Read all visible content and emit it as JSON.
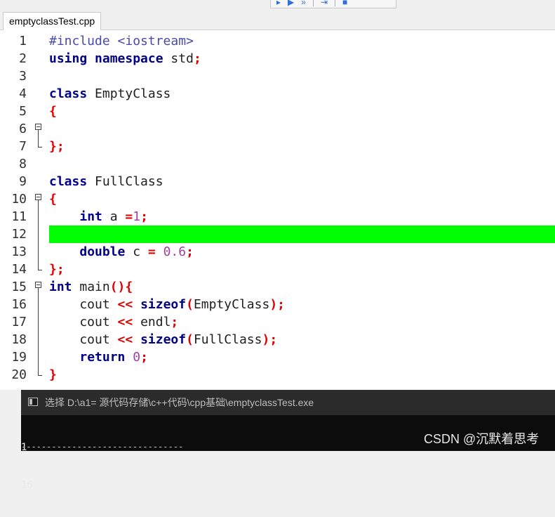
{
  "tab": {
    "file_name": "emptyclassTest.cpp"
  },
  "editor": {
    "lines": [
      {
        "num": "1",
        "segments": [
          {
            "t": "#include <iostream>",
            "c": "pp"
          }
        ]
      },
      {
        "num": "2",
        "segments": [
          {
            "t": "using",
            "c": "kw"
          },
          {
            "t": " ",
            "c": "pl"
          },
          {
            "t": "namespace",
            "c": "kw"
          },
          {
            "t": " std",
            "c": "pl"
          },
          {
            "t": ";",
            "c": "br"
          }
        ]
      },
      {
        "num": "3",
        "segments": []
      },
      {
        "num": "4",
        "segments": [
          {
            "t": "class",
            "c": "kw"
          },
          {
            "t": " EmptyClass",
            "c": "pl"
          }
        ]
      },
      {
        "num": "5",
        "segments": [
          {
            "t": "{",
            "c": "br"
          }
        ]
      },
      {
        "num": "6",
        "segments": []
      },
      {
        "num": "7",
        "segments": [
          {
            "t": "}",
            "c": "br"
          },
          {
            "t": ";",
            "c": "br"
          }
        ]
      },
      {
        "num": "8",
        "segments": []
      },
      {
        "num": "9",
        "segments": [
          {
            "t": "class",
            "c": "kw"
          },
          {
            "t": " FullClass",
            "c": "pl"
          }
        ]
      },
      {
        "num": "10",
        "segments": [
          {
            "t": "{",
            "c": "br"
          }
        ]
      },
      {
        "num": "11",
        "segments": [
          {
            "t": "    ",
            "c": "pl"
          },
          {
            "t": "int",
            "c": "kw"
          },
          {
            "t": " a ",
            "c": "pl"
          },
          {
            "t": "=",
            "c": "op"
          },
          {
            "t": "1",
            "c": "num"
          },
          {
            "t": ";",
            "c": "br"
          }
        ]
      },
      {
        "num": "12",
        "segments": [],
        "highlight": true
      },
      {
        "num": "13",
        "segments": [
          {
            "t": "    ",
            "c": "pl"
          },
          {
            "t": "double",
            "c": "kw"
          },
          {
            "t": " c ",
            "c": "pl"
          },
          {
            "t": "=",
            "c": "op"
          },
          {
            "t": " ",
            "c": "pl"
          },
          {
            "t": "0.6",
            "c": "num"
          },
          {
            "t": ";",
            "c": "br"
          }
        ]
      },
      {
        "num": "14",
        "segments": [
          {
            "t": "}",
            "c": "br"
          },
          {
            "t": ";",
            "c": "br"
          }
        ]
      },
      {
        "num": "15",
        "segments": [
          {
            "t": "int",
            "c": "kw"
          },
          {
            "t": " main",
            "c": "pl"
          },
          {
            "t": "(){",
            "c": "br"
          }
        ]
      },
      {
        "num": "16",
        "segments": [
          {
            "t": "    cout ",
            "c": "pl"
          },
          {
            "t": "<<",
            "c": "op"
          },
          {
            "t": " ",
            "c": "pl"
          },
          {
            "t": "sizeof",
            "c": "kw"
          },
          {
            "t": "(",
            "c": "br"
          },
          {
            "t": "EmptyClass",
            "c": "pl"
          },
          {
            "t": ");",
            "c": "br"
          }
        ]
      },
      {
        "num": "17",
        "segments": [
          {
            "t": "    cout ",
            "c": "pl"
          },
          {
            "t": "<<",
            "c": "op"
          },
          {
            "t": " endl",
            "c": "pl"
          },
          {
            "t": ";",
            "c": "br"
          }
        ]
      },
      {
        "num": "18",
        "segments": [
          {
            "t": "    cout ",
            "c": "pl"
          },
          {
            "t": "<<",
            "c": "op"
          },
          {
            "t": " ",
            "c": "pl"
          },
          {
            "t": "sizeof",
            "c": "kw"
          },
          {
            "t": "(",
            "c": "br"
          },
          {
            "t": "FullClass",
            "c": "pl"
          },
          {
            "t": ");",
            "c": "br"
          }
        ]
      },
      {
        "num": "19",
        "segments": [
          {
            "t": "    ",
            "c": "pl"
          },
          {
            "t": "return",
            "c": "kw"
          },
          {
            "t": " ",
            "c": "pl"
          },
          {
            "t": "0",
            "c": "num"
          },
          {
            "t": ";",
            "c": "br"
          }
        ]
      },
      {
        "num": "20",
        "segments": [
          {
            "t": "}",
            "c": "br"
          }
        ]
      }
    ],
    "highlight_color": "#00ff00"
  },
  "console": {
    "title": "选择 D:\\a1= 源代码存储\\c++代码\\cpp基础\\emptyclassTest.exe",
    "output_lines": [
      "1",
      "16"
    ],
    "separator": "--------------------------------"
  },
  "watermark": {
    "text": "CSDN @沉默着思考"
  }
}
